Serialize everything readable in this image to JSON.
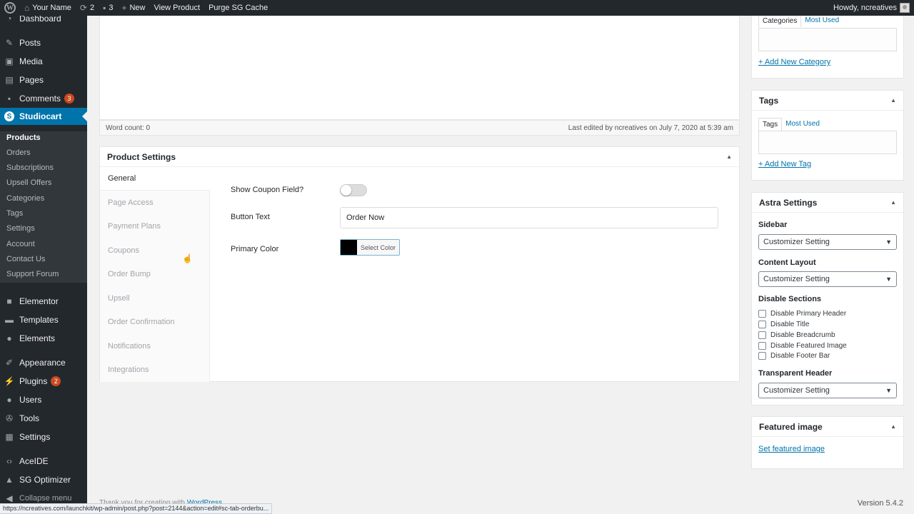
{
  "adminbar": {
    "site_name": "Your Name",
    "updates_count": "2",
    "comments_count": "3",
    "new_label": "New",
    "view_product": "View Product",
    "purge_cache": "Purge SG Cache",
    "howdy": "Howdy, ncreatives"
  },
  "menu": {
    "dashboard": "Dashboard",
    "posts": "Posts",
    "media": "Media",
    "pages": "Pages",
    "comments": "Comments",
    "comments_badge": "3",
    "studiocart": "Studiocart",
    "sub": [
      "Products",
      "Orders",
      "Subscriptions",
      "Upsell Offers",
      "Categories",
      "Tags",
      "Settings",
      "Account",
      "Contact Us",
      "Support Forum"
    ],
    "elementor": "Elementor",
    "templates": "Templates",
    "elements": "Elements",
    "appearance": "Appearance",
    "plugins": "Plugins",
    "plugins_badge": "2",
    "users": "Users",
    "tools": "Tools",
    "settings": "Settings",
    "aceide": "AceIDE",
    "sg_optimizer": "SG Optimizer",
    "collapse": "Collapse menu"
  },
  "editor": {
    "word_count": "Word count: 0",
    "last_edited": "Last edited by ncreatives on July 7, 2020 at 5:39 am"
  },
  "product_settings": {
    "title": "Product Settings",
    "tabs": [
      "General",
      "Page Access",
      "Payment Plans",
      "Coupons",
      "Order Bump",
      "Upsell",
      "Order Confirmation",
      "Notifications",
      "Integrations"
    ],
    "show_coupon_label": "Show Coupon Field?",
    "button_text_label": "Button Text",
    "button_text_value": "Order Now",
    "primary_color_label": "Primary Color",
    "select_color": "Select Color",
    "primary_color_value": "#000000"
  },
  "categories": {
    "tab_all": "Categories",
    "tab_most_used": "Most Used",
    "add_link": "+ Add New Category"
  },
  "tags": {
    "title": "Tags",
    "tab_all": "Tags",
    "tab_most_used": "Most Used",
    "add_link": "+ Add New Tag"
  },
  "astra": {
    "title": "Astra Settings",
    "sidebar_label": "Sidebar",
    "sidebar_value": "Customizer Setting",
    "content_layout_label": "Content Layout",
    "content_layout_value": "Customizer Setting",
    "disable_sections_label": "Disable Sections",
    "disable_options": [
      "Disable Primary Header",
      "Disable Title",
      "Disable Breadcrumb",
      "Disable Featured Image",
      "Disable Footer Bar"
    ],
    "transparent_header_label": "Transparent Header",
    "transparent_header_value": "Customizer Setting"
  },
  "featured": {
    "title": "Featured image",
    "set_link": "Set featured image"
  },
  "footer": {
    "thanks_prefix": "Thank you for creating with",
    "thanks_link": "WordPress",
    "version": "Version 5.4.2"
  },
  "status_url": "https://ncreatives.com/launchkit/wp-admin/post.php?post=2144&action=edit#sc-tab-orderbu..."
}
